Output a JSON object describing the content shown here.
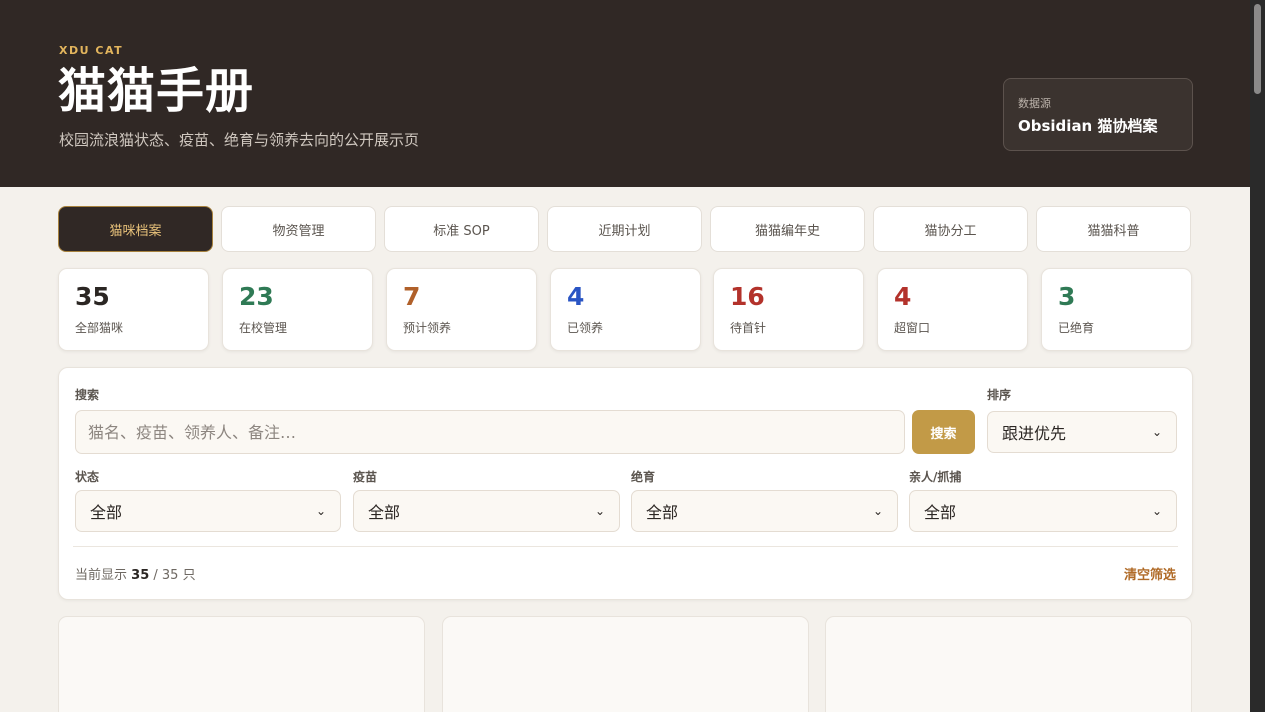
{
  "header": {
    "kicker": "XDU CAT",
    "title": "猫猫手册",
    "subtitle": "校园流浪猫状态、疫苗、绝育与领养去向的公开展示页",
    "source_label": "数据源",
    "source_value": "Obsidian 猫协档案"
  },
  "tabs": [
    {
      "label": "猫咪档案",
      "active": true
    },
    {
      "label": "物资管理"
    },
    {
      "label": "标准 SOP"
    },
    {
      "label": "近期计划"
    },
    {
      "label": "猫猫编年史"
    },
    {
      "label": "猫协分工"
    },
    {
      "label": "猫猫科普"
    }
  ],
  "stats": [
    {
      "value": "35",
      "label": "全部猫咪",
      "color": "#2b2623"
    },
    {
      "value": "23",
      "label": "在校管理",
      "color": "#2f7a55"
    },
    {
      "value": "7",
      "label": "预计领养",
      "color": "#b0602a"
    },
    {
      "value": "4",
      "label": "已领养",
      "color": "#2a55c4"
    },
    {
      "value": "16",
      "label": "待首针",
      "color": "#b3322b"
    },
    {
      "value": "4",
      "label": "超窗口",
      "color": "#b3322b"
    },
    {
      "value": "3",
      "label": "已绝育",
      "color": "#2f7a55"
    }
  ],
  "filters": {
    "search_label": "搜索",
    "search_placeholder": "猫名、疫苗、领养人、备注…",
    "search_button": "搜索",
    "sort_label": "排序",
    "sort_value": "跟进优先",
    "status_label": "状态",
    "status_value": "全部",
    "vaccine_label": "疫苗",
    "vaccine_value": "全部",
    "neuter_label": "绝育",
    "neuter_value": "全部",
    "capture_label": "亲人/抓捕",
    "capture_value": "全部",
    "count_prefix": "当前显示",
    "count_shown": "35",
    "count_total": "/ 35 只",
    "clear_label": "清空筛选"
  },
  "icons": {
    "select_chevron": "chevron-down-icon"
  }
}
